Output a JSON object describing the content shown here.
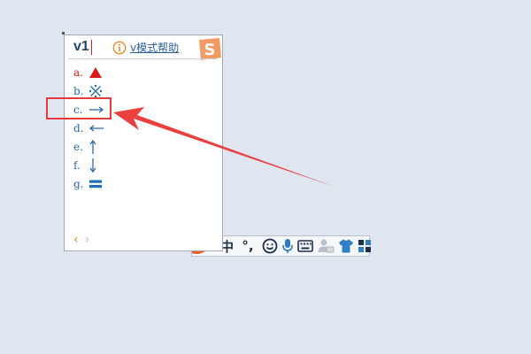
{
  "ime": {
    "composition": "v1",
    "help_link": "v模式帮助",
    "candidates": [
      {
        "label": "a.",
        "symbol": "▲",
        "icon": "filled-triangle-up-icon",
        "color": "#cc2020"
      },
      {
        "label": "b.",
        "symbol": "※",
        "icon": "reference-mark-icon",
        "color": "#2c6aa0"
      },
      {
        "label": "c.",
        "symbol": "→",
        "icon": "arrow-right-icon",
        "color": "#2c6aa0"
      },
      {
        "label": "d.",
        "symbol": "←",
        "icon": "arrow-left-icon",
        "color": "#2c6aa0"
      },
      {
        "label": "e.",
        "symbol": "↑",
        "icon": "arrow-up-icon",
        "color": "#2c6aa0"
      },
      {
        "label": "f.",
        "symbol": "↓",
        "icon": "arrow-down-icon",
        "color": "#2c6aa0"
      },
      {
        "label": "g.",
        "symbol": "〓",
        "icon": "geta-mark-icon",
        "color": "#2c6aa0"
      }
    ],
    "pager": {
      "prev": "‹",
      "next": "›"
    }
  },
  "status_bar": {
    "mode": "中",
    "punctuation": "°,"
  },
  "annotation": {
    "highlight_color": "#e43c3c"
  }
}
